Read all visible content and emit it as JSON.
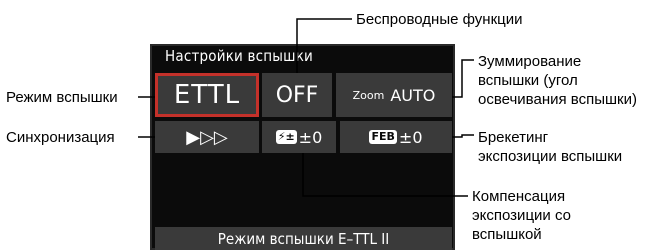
{
  "screen": {
    "title": "Настройки вспышки",
    "flash_mode_value": "ETTL",
    "wireless_value": "OFF",
    "zoom_label": "Zoom",
    "zoom_value": "AUTO",
    "sync_value": "▶▷▷",
    "comp_icon": "⚡±",
    "comp_value": "±0",
    "feb_icon": "FEB",
    "feb_value": "±0",
    "status_text": "Режим вспышки E–TTL II"
  },
  "callouts": {
    "wireless": "Беспроводные функции",
    "zoom_line1": "Зуммирование",
    "zoom_line2": "вспышки (угол",
    "zoom_line3": "освечивания вспышки)",
    "flash_mode": "Режим вспышки",
    "sync": "Синхронизация",
    "feb_line1": "Брекетинг",
    "feb_line2": "экспозиции вспышки",
    "comp_line1": "Компенсация",
    "comp_line2": "экспозиции со",
    "comp_line3": "вспышкой"
  },
  "colors": {
    "selection_border": "#c4312a",
    "tile_bg": "#3a3a3a",
    "screen_bg": "#0b0b0b"
  }
}
